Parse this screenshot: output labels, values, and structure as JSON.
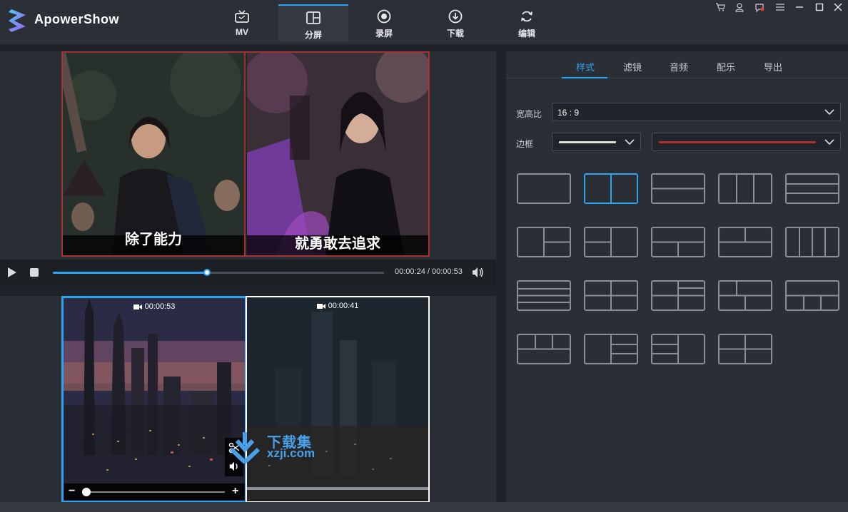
{
  "app": {
    "name": "ApowerShow"
  },
  "nav": {
    "tabs": [
      {
        "label": "MV",
        "icon": "tv-icon"
      },
      {
        "label": "分屏",
        "icon": "split-screen-icon",
        "active": true
      },
      {
        "label": "录屏",
        "icon": "record-icon"
      },
      {
        "label": "下载",
        "icon": "download-icon"
      },
      {
        "label": "编辑",
        "icon": "refresh-edit-icon"
      }
    ]
  },
  "window_controls": [
    "cart-icon",
    "user-icon",
    "notification-icon",
    "menu-icon",
    "minimize-icon",
    "maximize-icon",
    "close-icon"
  ],
  "preview": {
    "left_subtitle": "除了能力",
    "right_subtitle": "就勇敢去追求",
    "progress_fraction": 0.465,
    "time": "00:00:24 / 00:00:53"
  },
  "clips": [
    {
      "duration": "00:00:53",
      "selected": true
    },
    {
      "duration": "00:00:41",
      "selected": false
    }
  ],
  "watermark": {
    "title": "下载集",
    "subtitle": "xzji.com"
  },
  "panel": {
    "tabs": [
      {
        "label": "样式",
        "active": true
      },
      {
        "label": "滤镜"
      },
      {
        "label": "音频"
      },
      {
        "label": "配乐"
      },
      {
        "label": "导出"
      }
    ],
    "aspect": {
      "label": "宽高比",
      "value": "16 : 9"
    },
    "border": {
      "label": "边框",
      "line_color": "#e0e0e0",
      "border_color": "#b03030"
    },
    "layouts_count": 19,
    "selected_layout": "two-columns"
  },
  "colors": {
    "accent": "#2aa4f4",
    "frame_red": "#a63232"
  }
}
